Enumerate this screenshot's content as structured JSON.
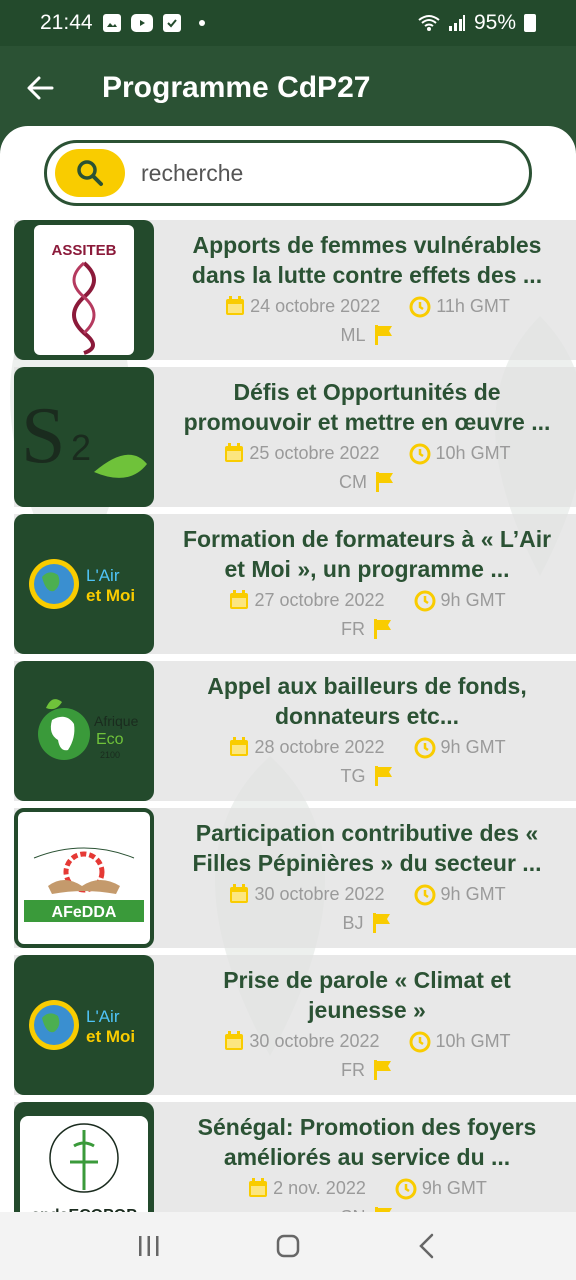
{
  "status": {
    "time": "21:44",
    "battery": "95%"
  },
  "app_bar": {
    "title": "Programme CdP27"
  },
  "search": {
    "placeholder": "recherche"
  },
  "colors": {
    "primary": "#2b5234",
    "accent": "#f9cc00"
  },
  "items": [
    {
      "title": "Apports de femmes vulnérables dans la  lutte contre effets des ...",
      "date": "24 octobre 2022",
      "time": "11h GMT",
      "lang": "ML",
      "logo": "ASSITEB BORF",
      "logo_type": "assiteb"
    },
    {
      "title": "Défis et Opportunités de promouvoir et mettre en œuvre ...",
      "date": "25 octobre 2022",
      "time": "10h GMT",
      "lang": "CM",
      "logo": "S2 SERVICES",
      "logo_type": "s2"
    },
    {
      "title": "Formation de formateurs à « L’Air et Moi », un programme ...",
      "date": "27 octobre 2022",
      "time": "9h GMT",
      "lang": "FR",
      "logo": "L'Air et Moi",
      "logo_type": "airmoi"
    },
    {
      "title": "Appel aux bailleurs de fonds, donnateurs etc...",
      "date": "28 octobre 2022",
      "time": "9h GMT",
      "lang": "TG",
      "logo": "Afrique Eco 2100",
      "logo_type": "afrique"
    },
    {
      "title": "Participation contributive des « Filles Pépinières » du secteur ...",
      "date": "30 octobre 2022",
      "time": "9h GMT",
      "lang": "BJ",
      "logo": "AFeDDA",
      "logo_type": "afedda"
    },
    {
      "title": "Prise de parole « Climat et jeunesse »",
      "date": "30 octobre 2022",
      "time": "10h GMT",
      "lang": "FR",
      "logo": "L'Air et Moi",
      "logo_type": "airmoi"
    },
    {
      "title": "Sénégal: Promotion des foyers améliorés au service du ...",
      "date": "2 nov. 2022",
      "time": "9h GMT",
      "lang": "SN",
      "logo": "endaECOPOP",
      "logo_type": "enda"
    }
  ]
}
